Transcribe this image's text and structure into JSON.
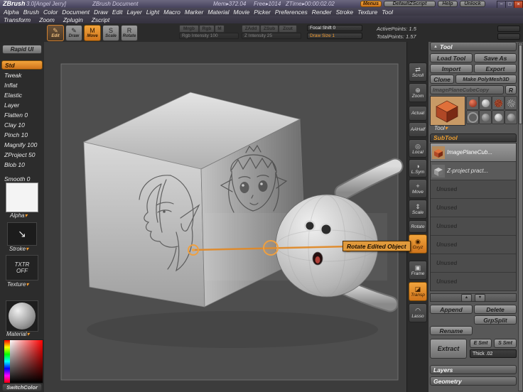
{
  "colors": {
    "accent": "#e08a2a"
  },
  "ui": {
    "flyout_arrow": "▾",
    "palette_arrow": "▲"
  },
  "window": {
    "app": "ZBrush",
    "version": "3.0[Angel Jerry]",
    "document": "ZBrush Document",
    "mem": "Mem▸372.04",
    "free": "Free▸1014",
    "ztime": "ZTime▸00:00:02.02",
    "menus_button": "Menus",
    "zscript_button": "DefaultZScript",
    "help_button": "Help",
    "unlock_button": "Unlock",
    "min_glyph": "−",
    "restore_glyph": "□",
    "close_glyph": "×"
  },
  "menu_row1": [
    "Alpha",
    "Brush",
    "Color",
    "Document",
    "Draw",
    "Edit",
    "Layer",
    "Light",
    "Macro",
    "Marker",
    "Material",
    "Movie",
    "Picker",
    "Preferences",
    "Render",
    "Stroke",
    "Texture",
    "Tool"
  ],
  "menu_row2": [
    "Transform",
    "Zoom",
    "Zplugin",
    "Zscript"
  ],
  "toolbar": {
    "edit": {
      "label": "Edit",
      "icon": "✎"
    },
    "draw": {
      "label": "Draw",
      "icon": "✎"
    },
    "move": {
      "label": "Move",
      "icon": "M"
    },
    "scale": {
      "label": "Scale",
      "icon": "S"
    },
    "rotate": {
      "label": "Rotate",
      "icon": "R"
    },
    "mrgb": "Mrgb",
    "rgb": "Rgb",
    "m": "M",
    "rgb_intensity": "Rgb Intensity 100",
    "zadd": "ZAdd",
    "zsub": "ZSub",
    "zcut": "Zcut",
    "z_intensity": "Z Intensity 25",
    "focal_shift": "Focal Shift 0",
    "draw_size": "Draw Size 1",
    "active_points": "ActivePoints: 1.5",
    "total_points": "TotalPoints: 1.57"
  },
  "left_shelf": {
    "rapid_ui": "Rapid UI",
    "brushes": [
      "Std",
      "Tweak",
      "Inflat",
      "Elastic",
      "Layer",
      "Flatten 0",
      "Clay 10",
      "Pinch 10",
      "Magnify 100",
      "ZProject 50",
      "Blob 10"
    ],
    "smooth": "Smooth 0",
    "alpha_label": "Alpha",
    "stroke_icon": "↘",
    "stroke_label": "Stroke",
    "texture_off_line1": "TXTR",
    "texture_off_line2": "OFF",
    "texture_label": "Texture",
    "material_label": "Material",
    "switch_color": "SwitchColor"
  },
  "right_toolbar": [
    {
      "label": "Scroll",
      "icon": "⇄"
    },
    {
      "label": "Zoom",
      "icon": "⊕"
    },
    {
      "label": "Actual",
      "icon": ""
    },
    {
      "label": "AAHalf",
      "icon": ""
    },
    {
      "label": "Local",
      "icon": "◎"
    },
    {
      "label": "L.Sym",
      "icon": "◑"
    },
    {
      "label": "Move",
      "icon": "+"
    },
    {
      "label": "Scale",
      "icon": "⇕"
    },
    {
      "label": "Rotate",
      "icon": ""
    },
    {
      "label": "Gxyz",
      "icon": "◉"
    },
    {
      "label": "Frame",
      "icon": "▣"
    },
    {
      "label": "Transp",
      "icon": "◪"
    },
    {
      "label": "Lasso",
      "icon": "◠"
    }
  ],
  "tool_panel": {
    "header": "Tool",
    "load_tool": "Load Tool",
    "save_as": "Save As",
    "import": "Import",
    "export": "Export",
    "clone": "Clone",
    "make_polymesh": "Make PolyMesh3D",
    "current_tool": "ImagePlaneCubeCopy",
    "r_button": "R",
    "tool_flyout": "Tool",
    "subtool": {
      "header": "SubTool",
      "items": [
        {
          "name": "ImagePlaneCub...",
          "selected": true
        },
        {
          "name": "Z-project pract...",
          "selected": false
        },
        {
          "name": "Unused"
        },
        {
          "name": "Unused"
        },
        {
          "name": "Unused"
        },
        {
          "name": "Unused"
        },
        {
          "name": "Unused"
        },
        {
          "name": "Unused"
        }
      ],
      "up_glyph": "▲",
      "down_glyph": "▼",
      "append": "Append",
      "delete": "Delete",
      "grpsplit": "GrpSplit",
      "rename": "Rename",
      "extract": "Extract",
      "e_smt": "E Smt",
      "s_smt": "S Smt",
      "thick": "Thick .02"
    },
    "layers_header": "Layers",
    "geometry_header": "Geometry"
  },
  "canvas": {
    "tooltip": "Rotate Edited Object"
  }
}
